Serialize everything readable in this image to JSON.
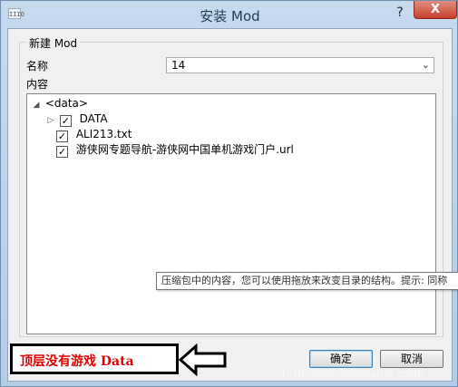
{
  "window": {
    "title": "安装 Mod",
    "icon_text": "IIIO",
    "help_glyph": "?",
    "close_glyph": "X"
  },
  "group": {
    "title": "新建 Mod"
  },
  "name_field": {
    "label": "名称",
    "value": "14",
    "arrow": "⌄"
  },
  "content": {
    "label": "内容",
    "tree": [
      {
        "label": "<data>",
        "expander": "◢",
        "checked": null,
        "depth": 0
      },
      {
        "label": "DATA",
        "expander": "▷",
        "checked": true,
        "depth": 1
      },
      {
        "label": "ALI213.txt",
        "expander": "",
        "checked": true,
        "depth": 1
      },
      {
        "label": "游侠网专题导航-游侠网中国单机游戏门户.url",
        "expander": "",
        "checked": true,
        "depth": 1
      }
    ]
  },
  "tooltip": {
    "text": "压缩包中的内容，您可以使用拖放来改变目录的结构。提示: 同称"
  },
  "buttons": {
    "ok": "确定",
    "cancel": "取消"
  },
  "annotation": {
    "text": "顶层没有游戏 Data",
    "color": "#e00000"
  },
  "watermark": {
    "text": "http://bbs.3dmgame.com/"
  },
  "colors": {
    "close_button": "#c7412b",
    "title_bar": "#c6dbee",
    "dialog_bg": "#f0f0f0"
  }
}
